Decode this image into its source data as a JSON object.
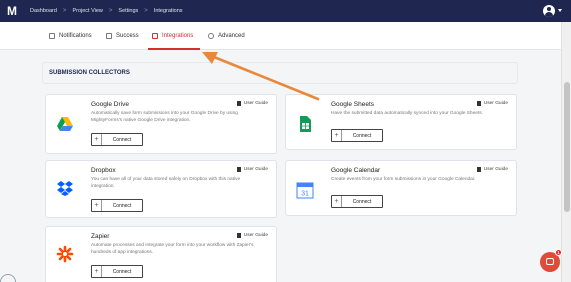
{
  "header": {
    "logo": "M",
    "breadcrumbs": [
      "Dashboard",
      "Project View",
      "Settings",
      "Integrations"
    ],
    "separator": ">"
  },
  "tabs": [
    {
      "label": "Notifications",
      "icon": "chat-icon",
      "active": false
    },
    {
      "label": "Success",
      "icon": "success-icon",
      "active": false
    },
    {
      "label": "Integrations",
      "icon": "integrations-icon",
      "active": true
    },
    {
      "label": "Advanced",
      "icon": "gear-icon",
      "active": false
    }
  ],
  "section": {
    "title": "SUBMISSION COLLECTORS"
  },
  "cards": [
    {
      "name": "Google Drive",
      "description": "Automatically save form submissions into your Google Drive by using MightyForms's native Google Drive integration.",
      "guide": "User Guide",
      "button": "Connect",
      "icon": "google-drive-icon"
    },
    {
      "name": "Google Sheets",
      "description": "Have the submitted data automatically synced into your Google Sheets.",
      "guide": "User Guide",
      "button": "Connect",
      "icon": "google-sheets-icon"
    },
    {
      "name": "Dropbox",
      "description": "You can have all of your data stored safely on Dropbox with this native integration.",
      "guide": "User Guide",
      "button": "Connect",
      "icon": "dropbox-icon"
    },
    {
      "name": "Google Calendar",
      "description": "Create events from your form submissions in your Google Calendar.",
      "guide": "User Guide",
      "button": "Connect",
      "icon": "google-calendar-icon",
      "icon_text": "31"
    },
    {
      "name": "Zapier",
      "description": "Automate processes and integrate your form into your workflow with Zapier's hundreds of app integrations.",
      "guide": "User Guide",
      "button": "Connect",
      "icon": "zapier-icon"
    }
  ],
  "chat": {
    "badge": "1"
  },
  "colors": {
    "accent": "#d32f2f",
    "header": "#1f2750",
    "annotation_arrow": "#e8893a"
  }
}
